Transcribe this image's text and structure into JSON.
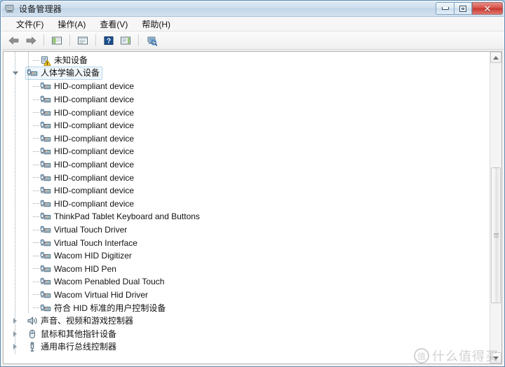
{
  "window": {
    "title": "设备管理器",
    "title_icon": "device-manager-icon",
    "buttons": {
      "minimize": "最小化",
      "maximize": "最大化",
      "close": "关闭",
      "close_glyph": "✕"
    }
  },
  "menu": {
    "items": [
      {
        "label": "文件(F)",
        "name": "menu-file"
      },
      {
        "label": "操作(A)",
        "name": "menu-action"
      },
      {
        "label": "查看(V)",
        "name": "menu-view"
      },
      {
        "label": "帮助(H)",
        "name": "menu-help"
      }
    ]
  },
  "toolbar": {
    "items": [
      {
        "name": "back-button",
        "icon": "arrow-left-icon",
        "tip": "后退"
      },
      {
        "name": "forward-button",
        "icon": "arrow-right-icon",
        "tip": "前进"
      },
      {
        "name": "separator-1",
        "icon": "separator"
      },
      {
        "name": "show-hide-console-tree-button",
        "icon": "console-tree-icon",
        "tip": "显示/隐藏控制台树"
      },
      {
        "name": "separator-2",
        "icon": "separator"
      },
      {
        "name": "properties-button",
        "icon": "properties-icon",
        "tip": "属性"
      },
      {
        "name": "separator-3",
        "icon": "separator"
      },
      {
        "name": "help-button",
        "icon": "help-icon",
        "tip": "帮助"
      },
      {
        "name": "update-driver-button",
        "icon": "update-driver-icon",
        "tip": "更新驱动程序软件"
      },
      {
        "name": "separator-4",
        "icon": "separator"
      },
      {
        "name": "scan-hardware-changes-button",
        "icon": "scan-hardware-icon",
        "tip": "扫描检测硬件改动"
      }
    ]
  },
  "tree": {
    "rows": [
      {
        "label": "未知设备",
        "icon": "unknown-device-warning-icon",
        "indent": 2,
        "expander": "none",
        "selected": false,
        "name": "tree-item-unknown-device"
      },
      {
        "label": "人体学输入设备",
        "icon": "hid-category-icon",
        "indent": 1,
        "expander": "open",
        "selected": true,
        "name": "tree-item-human-interface-devices"
      },
      {
        "label": "HID-compliant device",
        "icon": "hid-device-icon",
        "indent": 2,
        "expander": "none",
        "selected": false,
        "name": "tree-item-hid-compliant-device"
      },
      {
        "label": "HID-compliant device",
        "icon": "hid-device-icon",
        "indent": 2,
        "expander": "none",
        "selected": false,
        "name": "tree-item-hid-compliant-device"
      },
      {
        "label": "HID-compliant device",
        "icon": "hid-device-icon",
        "indent": 2,
        "expander": "none",
        "selected": false,
        "name": "tree-item-hid-compliant-device"
      },
      {
        "label": "HID-compliant device",
        "icon": "hid-device-icon",
        "indent": 2,
        "expander": "none",
        "selected": false,
        "name": "tree-item-hid-compliant-device"
      },
      {
        "label": "HID-compliant device",
        "icon": "hid-device-icon",
        "indent": 2,
        "expander": "none",
        "selected": false,
        "name": "tree-item-hid-compliant-device"
      },
      {
        "label": "HID-compliant device",
        "icon": "hid-device-icon",
        "indent": 2,
        "expander": "none",
        "selected": false,
        "name": "tree-item-hid-compliant-device"
      },
      {
        "label": "HID-compliant device",
        "icon": "hid-device-icon",
        "indent": 2,
        "expander": "none",
        "selected": false,
        "name": "tree-item-hid-compliant-device"
      },
      {
        "label": "HID-compliant device",
        "icon": "hid-device-icon",
        "indent": 2,
        "expander": "none",
        "selected": false,
        "name": "tree-item-hid-compliant-device"
      },
      {
        "label": "HID-compliant device",
        "icon": "hid-device-icon",
        "indent": 2,
        "expander": "none",
        "selected": false,
        "name": "tree-item-hid-compliant-device"
      },
      {
        "label": "HID-compliant device",
        "icon": "hid-device-icon",
        "indent": 2,
        "expander": "none",
        "selected": false,
        "name": "tree-item-hid-compliant-device"
      },
      {
        "label": "ThinkPad Tablet Keyboard and Buttons",
        "icon": "hid-device-icon",
        "indent": 2,
        "expander": "none",
        "selected": false,
        "name": "tree-item-thinkpad-tablet-keyboard"
      },
      {
        "label": "Virtual Touch Driver",
        "icon": "hid-device-icon",
        "indent": 2,
        "expander": "none",
        "selected": false,
        "name": "tree-item-virtual-touch-driver"
      },
      {
        "label": "Virtual Touch Interface",
        "icon": "hid-device-icon",
        "indent": 2,
        "expander": "none",
        "selected": false,
        "name": "tree-item-virtual-touch-interface"
      },
      {
        "label": "Wacom HID Digitizer",
        "icon": "hid-device-icon",
        "indent": 2,
        "expander": "none",
        "selected": false,
        "name": "tree-item-wacom-hid-digitizer"
      },
      {
        "label": "Wacom HID Pen",
        "icon": "hid-device-icon",
        "indent": 2,
        "expander": "none",
        "selected": false,
        "name": "tree-item-wacom-hid-pen"
      },
      {
        "label": "Wacom Penabled Dual Touch",
        "icon": "hid-device-icon",
        "indent": 2,
        "expander": "none",
        "selected": false,
        "name": "tree-item-wacom-penabled-dual-touch"
      },
      {
        "label": "Wacom Virtual Hid Driver",
        "icon": "hid-device-icon",
        "indent": 2,
        "expander": "none",
        "selected": false,
        "name": "tree-item-wacom-virtual-hid-driver"
      },
      {
        "label": "符合 HID 标准的用户控制设备",
        "icon": "hid-device-icon",
        "indent": 2,
        "expander": "none",
        "selected": false,
        "name": "tree-item-hid-user-control-device"
      },
      {
        "label": "声音、视频和游戏控制器",
        "icon": "sound-video-game-icon",
        "indent": 1,
        "expander": "closed",
        "selected": false,
        "name": "tree-item-sound-video-game-controllers"
      },
      {
        "label": "鼠标和其他指针设备",
        "icon": "mouse-icon",
        "indent": 1,
        "expander": "closed",
        "selected": false,
        "name": "tree-item-mice-and-pointing-devices"
      },
      {
        "label": "通用串行总线控制器",
        "icon": "usb-controller-icon",
        "indent": 1,
        "expander": "closed",
        "selected": false,
        "name": "tree-item-usb-controllers"
      }
    ]
  },
  "scrollbar": {
    "up_arrow": "▲",
    "down_arrow": "▼",
    "thumb_top_pct": 36,
    "thumb_height_pct": 47
  },
  "watermark": {
    "mark": "值",
    "text": "什么值得买"
  },
  "colors": {
    "accent": "#3b7cbd",
    "selection_border": "#b8d6ea",
    "selection_fill": "#f0f7fc",
    "close_button": "#c63a30",
    "warning": "#f5c518"
  }
}
